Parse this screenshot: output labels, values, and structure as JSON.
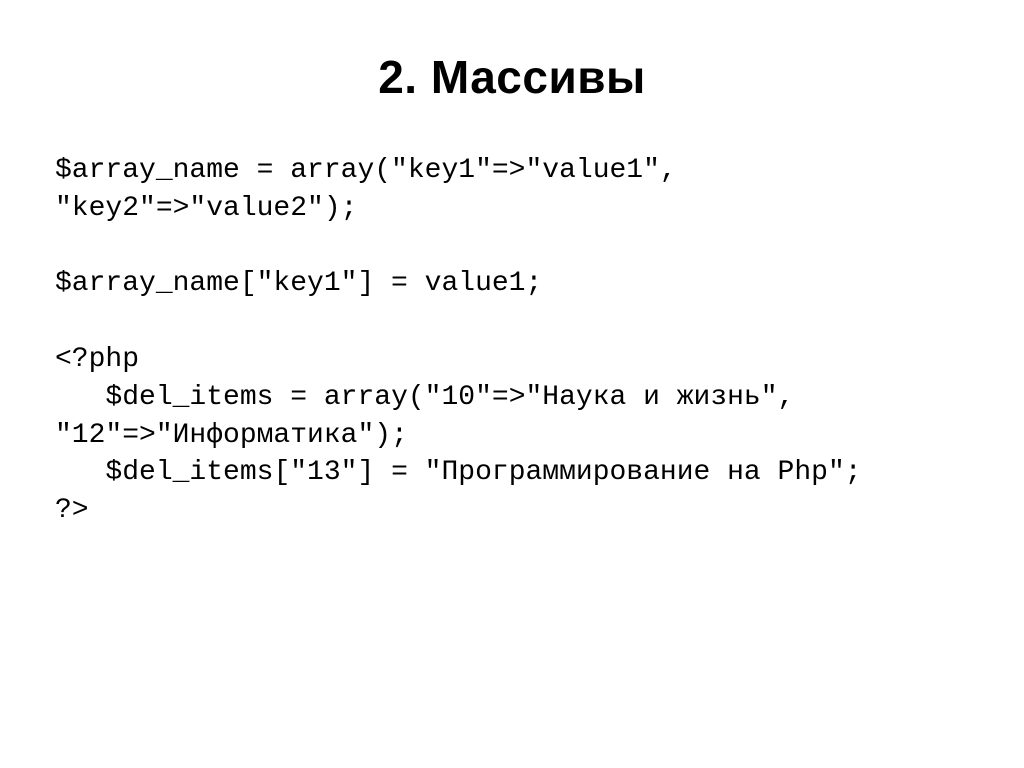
{
  "slide": {
    "title": "2. Массивы",
    "code_line1": "$array_name = array(\"key1\"=>\"value1\", \"key2\"=>\"value2\");",
    "blank1": "",
    "code_line2": "$array_name[\"key1\"] = value1;",
    "blank2": "",
    "code_line3": "<?php",
    "code_line4": "   $del_items = array(\"10\"=>\"Наука и жизнь\", \"12\"=>\"Информатика\");",
    "code_line5": "   $del_items[\"13\"] = \"Программирование на Php\";",
    "code_line6": "?>"
  }
}
